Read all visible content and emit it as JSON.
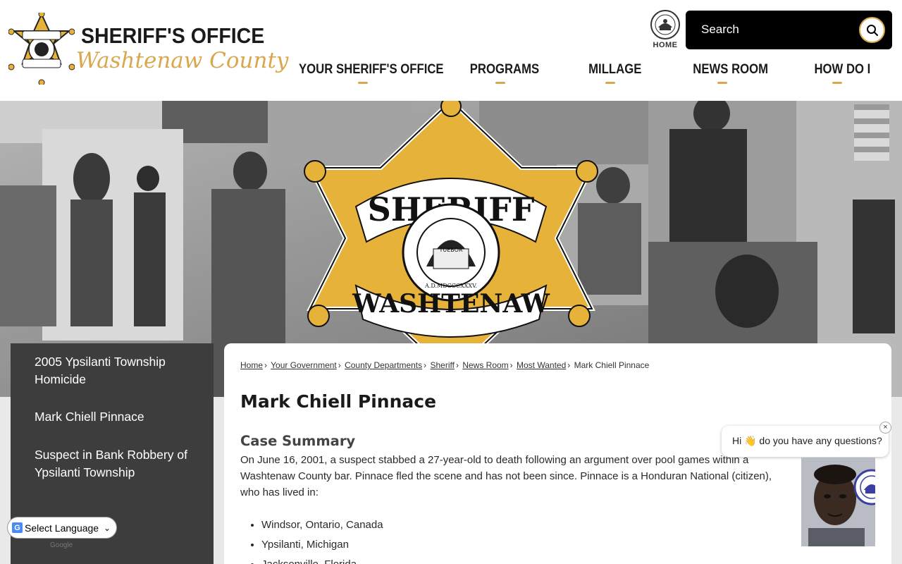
{
  "header": {
    "logo": {
      "title": "SHERIFF'S OFFICE",
      "subtitle": "Washtenaw County",
      "badge_text_top": "SHERIFF",
      "badge_text_bottom": "WASHTENAW"
    },
    "home_label": "HOME",
    "search": {
      "placeholder": "Search"
    },
    "nav": [
      {
        "label": "YOUR SHERIFF'S OFFICE"
      },
      {
        "label": "PROGRAMS"
      },
      {
        "label": "MILLAGE"
      },
      {
        "label": "NEWS ROOM"
      },
      {
        "label": "HOW DO I"
      }
    ]
  },
  "banner": {
    "badge_top": "SHERIFF",
    "badge_bottom": "WASHTENAW",
    "seal_text": "THE GREAT SEAL OF THE STATE OF MICHIGAN",
    "seal_motto": "TUEBOR",
    "seal_date": "A.D.MDCCCXXXV."
  },
  "sidebar": {
    "items": [
      {
        "label": "2005 Ypsilanti Township Homicide"
      },
      {
        "label": "Mark Chiell Pinnace"
      },
      {
        "label": "Suspect in Bank Robbery of Ypsilanti Township"
      }
    ]
  },
  "language": {
    "label": "Select Language",
    "powered_by": "Google"
  },
  "content": {
    "breadcrumb": [
      {
        "label": "Home"
      },
      {
        "label": "Your Government"
      },
      {
        "label": "County Departments"
      },
      {
        "label": "Sheriff"
      },
      {
        "label": "News Room"
      },
      {
        "label": "Most Wanted"
      }
    ],
    "breadcrumb_current": "Mark Chiell Pinnace",
    "title": "Mark Chiell Pinnace",
    "section_title": "Case Summary",
    "summary": "On June 16, 2001, a suspect stabbed a 27-year-old to death following an argument over pool games within a Washtenaw County bar. Pinnace fled the scene and has not been since. Pinnace is a Honduran National (citizen), who has lived in:",
    "places": [
      "Windsor, Ontario, Canada",
      "Ypsilanti, Michigan",
      "Jacksonville, Florida"
    ]
  },
  "chat": {
    "message": "Hi 👋 do you have any questions?",
    "close_label": "×"
  },
  "colors": {
    "gold": "#d9a84e",
    "dark": "#3d3d3d",
    "black": "#000000"
  }
}
